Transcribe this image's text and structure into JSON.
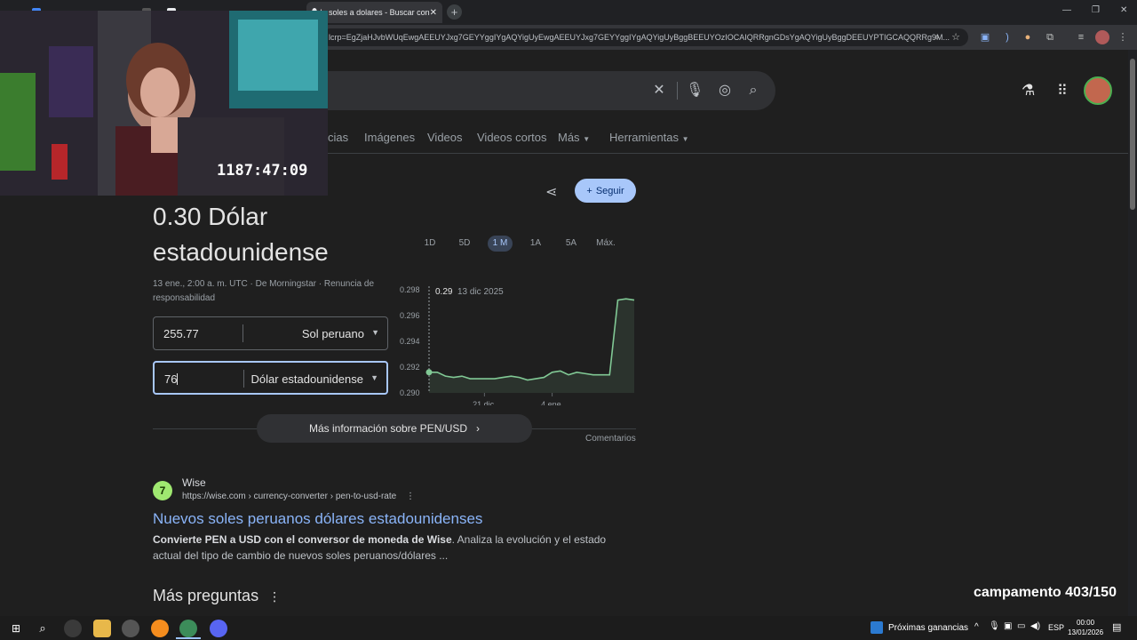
{
  "browser": {
    "active_tab_title": "le soles a dolares - Buscar con",
    "new_tab_label": "+",
    "url": "lcrp=EgZjaHJvbWUqEwgAEEUYJxg7GEYYggIYgAQYigUyEwgAEEUYJxg7GEYYggIYgAQYigUyBggBEEUYOzIOCAIQRRgnGDsYgAQYigUyBggDEEUYPTIGCAQQRRg9M...",
    "window_controls": [
      "—",
      "❐",
      "✕"
    ]
  },
  "search": {
    "icons": [
      "clear-icon",
      "mic-icon",
      "lens-icon",
      "search-icon"
    ]
  },
  "nav_tabs": [
    "cias",
    "Imágenes",
    "Videos",
    "Videos cortos",
    "Más",
    "Herramientas"
  ],
  "follow_button": "Seguir",
  "converter": {
    "headline": "0.30 Dólar estadounidense",
    "meta": "13 ene., 2:00 a. m. UTC · De Morningstar · Renuncia de responsabilidad",
    "from_amount": "255.77",
    "from_currency": "Sol peruano",
    "to_amount": "76",
    "to_currency": "Dólar estadounidense",
    "more_info": "Más información sobre PEN/USD",
    "feedback": "Comentarios"
  },
  "ranges": [
    "1D",
    "5D",
    "1 M",
    "1A",
    "5A",
    "Máx."
  ],
  "selected_range": "1 M",
  "chart_data": {
    "type": "area",
    "tooltip_value": "0.29",
    "tooltip_date": "13 dic 2025",
    "yticks": [
      "0.298",
      "0.296",
      "0.294",
      "0.292",
      "0.290"
    ],
    "xticks": [
      "21 dic.",
      "4 ene."
    ],
    "ylim": [
      0.29,
      0.298
    ],
    "values": [
      0.2916,
      0.2916,
      0.2913,
      0.2912,
      0.2913,
      0.2911,
      0.2911,
      0.2911,
      0.2911,
      0.2912,
      0.2913,
      0.2912,
      0.291,
      0.2911,
      0.2912,
      0.2916,
      0.2917,
      0.2914,
      0.2916,
      0.2915,
      0.2914,
      0.2914,
      0.2914,
      0.2972,
      0.2973,
      0.2972
    ],
    "color": "#81c995"
  },
  "result": {
    "favicon": "7",
    "site": "Wise",
    "url": "https://wise.com › currency-converter › pen-to-usd-rate",
    "title": "Nuevos soles peruanos dólares estadounidenses",
    "snippet_bold": "Convierte PEN a USD con el conversor de moneda de Wise",
    "snippet_rest": ". Analiza la evolución y el estado actual del tipo de cambio de nuevos soles peruanos/dólares ..."
  },
  "more_questions": "Más preguntas",
  "overlay": {
    "timer": "1187:47:09",
    "campamento": "campamento 403/150"
  },
  "taskbar": {
    "widget": "Próximas ganancias",
    "language": "ESP",
    "time": "00:00",
    "date": "13/01/2026"
  }
}
